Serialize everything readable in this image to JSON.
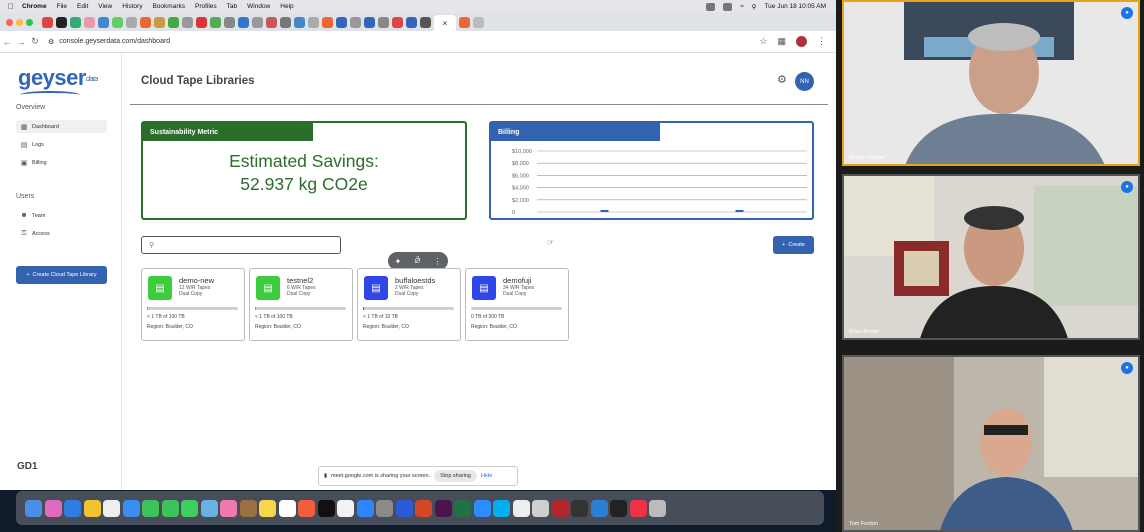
{
  "menubar": {
    "app": "Chrome",
    "items": [
      "File",
      "Edit",
      "View",
      "History",
      "Bookmarks",
      "Profiles",
      "Tab",
      "Window",
      "Help"
    ],
    "clock": "Tue Jun 18  10:05 AM"
  },
  "browser": {
    "url": "console.geyserdata.com/dashboard"
  },
  "sidebar": {
    "logo": "geyser",
    "logo_small": "data",
    "overview_heading": "Overview",
    "overview_items": [
      {
        "label": "Dashboard",
        "icon": "dashboard-icon"
      },
      {
        "label": "Logs",
        "icon": "document-icon"
      },
      {
        "label": "Billing",
        "icon": "receipt-icon"
      }
    ],
    "users_heading": "Users",
    "users_items": [
      {
        "label": "Team",
        "icon": "people-icon"
      },
      {
        "label": "Access",
        "icon": "key-icon"
      }
    ],
    "create_button": "Create Cloud Tape Library",
    "footer": "GD1"
  },
  "header": {
    "title": "Cloud Tape Libraries",
    "avatar": "NN"
  },
  "sustainability": {
    "header": "Sustainability Metric",
    "line1": "Estimated Savings:",
    "line2": "52.937 kg CO2e"
  },
  "billing": {
    "header": "Billing",
    "chart_data": {
      "type": "bar",
      "y_ticks": [
        "$10,000",
        "$8,000",
        "$6,000",
        "$4,000",
        "$2,000",
        "0"
      ],
      "ylim": [
        0,
        10000
      ],
      "categories": [
        "",
        ""
      ],
      "values": [
        150,
        150
      ],
      "grid": true,
      "bar_color": "#3362b0"
    }
  },
  "toolbar": {
    "search_placeholder": "",
    "create_label": "Create"
  },
  "libraries": [
    {
      "name": "demo-new",
      "tapes": "12 W/R Tapes",
      "copy": "Dual Copy",
      "usage": "< 1 TB of 100 TB",
      "usage_fraction": 0.005,
      "region": "Region: Boulder, CO",
      "color": "#3ccc3c"
    },
    {
      "name": "testnel2",
      "tapes": "6 W/R Tapes",
      "copy": "Dual Copy",
      "usage": "< 1 TB of 100 TB",
      "usage_fraction": 0.005,
      "region": "Region: Boulder, CO",
      "color": "#3ccc3c"
    },
    {
      "name": "buffaloestds",
      "tapes": "2 W/R Tapes",
      "copy": "Dual Copy",
      "usage": "< 1 TB of 10 TB",
      "usage_fraction": 0.01,
      "region": "Region: Boulder, CO",
      "color": "#2f46e8"
    },
    {
      "name": "demofuji",
      "tapes": "34 W/R Tapes",
      "copy": "Dual Copy",
      "usage": "0 TB of 300 TB",
      "usage_fraction": 0,
      "region": "Region: Boulder, CO",
      "color": "#2f46e8"
    }
  ],
  "share_banner": {
    "text": "meet.google.com is sharing your screen.",
    "stop": "Stop sharing",
    "hide": "Hide"
  },
  "participants": [
    {
      "name": "Nelson Nahum",
      "speaking": true
    },
    {
      "name": "Brian Beeler",
      "speaking": false
    },
    {
      "name": "Tom Fenton",
      "speaking": false
    }
  ],
  "colors": {
    "brand_blue": "#3362b0",
    "sustain_green": "#2b6e2b",
    "speaking_border": "#e8a317"
  }
}
